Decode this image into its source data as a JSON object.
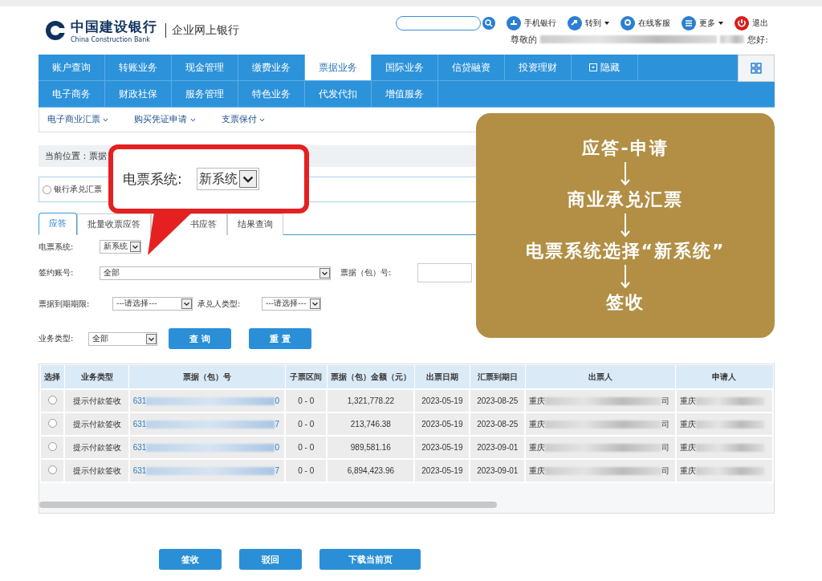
{
  "header": {
    "logo_cn": "中国建设银行",
    "logo_en": "China Construction Bank",
    "product": "企业网上银行",
    "links": [
      {
        "kind": "mobile",
        "label": "手机银行",
        "dropdown": false
      },
      {
        "kind": "goto",
        "label": "转到",
        "dropdown": true
      },
      {
        "kind": "service",
        "label": "在线客服",
        "dropdown": false
      },
      {
        "kind": "more",
        "label": "更多",
        "dropdown": true
      },
      {
        "kind": "exit",
        "label": "退出",
        "dropdown": false
      }
    ],
    "greeting_start": "尊敬的",
    "greeting_end": "您好:"
  },
  "nav": {
    "rows": [
      [
        {
          "label": "账户查询",
          "selected": false
        },
        {
          "label": "转账业务",
          "selected": false
        },
        {
          "label": "现金管理",
          "selected": false
        },
        {
          "label": "缴费业务",
          "selected": false
        },
        {
          "label": "票据业务",
          "selected": true
        },
        {
          "label": "国际业务",
          "selected": false
        },
        {
          "label": "信贷融资",
          "selected": false
        },
        {
          "label": "投资理财",
          "selected": false
        },
        {
          "label": "隐藏",
          "selected": false,
          "kind": "toggle"
        }
      ],
      [
        {
          "label": "电子商务",
          "selected": false
        },
        {
          "label": "财政社保",
          "selected": false
        },
        {
          "label": "服务管理",
          "selected": false
        },
        {
          "label": "特色业务",
          "selected": false
        },
        {
          "label": "代发代扣",
          "selected": false
        },
        {
          "label": "增值服务",
          "selected": false
        }
      ]
    ]
  },
  "subnav": [
    "电子商业汇票",
    "购买凭证申请",
    "支票保付"
  ],
  "breadcrumb": "当前位置：票据",
  "bill_type": {
    "label": "银行承兑汇票",
    "selected": false
  },
  "tabs": [
    {
      "label": "应答",
      "selected": true
    },
    {
      "label": "批量收票应答",
      "selected": false
    },
    {
      "label": "书应答",
      "selected": false
    },
    {
      "label": "结果查询",
      "selected": false
    }
  ],
  "form": {
    "system": {
      "label": "电票系统:",
      "value": "新系统"
    },
    "account": {
      "label": "签约账号:",
      "value": "全部"
    },
    "bill_no": {
      "label": "票据（包）号:"
    },
    "term": {
      "label": "票据到期期限:",
      "value": "---请选择---"
    },
    "acceptor": {
      "label": "承兑人类型:",
      "value": "---请选择---"
    },
    "biz_type": {
      "label": "业务类型:",
      "value": "全部"
    },
    "buttons": [
      "查 询",
      "重 置"
    ]
  },
  "table": {
    "columns": [
      "选择",
      "业务类型",
      "票据（包）号",
      "子票区间",
      "票据（包）金额（元）",
      "出票日期",
      "汇票到期日",
      "出票人",
      "申请人"
    ],
    "rows": [
      {
        "selected": false,
        "type": "提示付款签收",
        "bill_prefix": "631",
        "bill_suffix": "0",
        "range": "0 - 0",
        "amount": "1,321,778.22",
        "issue": "2023-05-19",
        "due": "2023-08-25",
        "drawer_prefix": "重庆",
        "drawer_suffix": "司",
        "applicant_prefix": "重庆"
      },
      {
        "selected": false,
        "type": "提示付款签收",
        "bill_prefix": "631",
        "bill_suffix": "7",
        "range": "0 - 0",
        "amount": "213,746.38",
        "issue": "2023-05-19",
        "due": "2023-08-25",
        "drawer_prefix": "重庆",
        "drawer_suffix": "司",
        "applicant_prefix": "重庆"
      },
      {
        "selected": false,
        "type": "提示付款签收",
        "bill_prefix": "631",
        "bill_suffix": "0",
        "range": "0 - 0",
        "amount": "989,581.16",
        "issue": "2023-05-19",
        "due": "2023-09-01",
        "drawer_prefix": "重庆",
        "drawer_suffix": "司",
        "applicant_prefix": "重庆"
      },
      {
        "selected": false,
        "type": "提示付款签收",
        "bill_prefix": "631",
        "bill_suffix": "7",
        "range": "0 - 0",
        "amount": "6,894,423.96",
        "issue": "2023-05-19",
        "due": "2023-09-01",
        "drawer_prefix": "重庆",
        "drawer_suffix": "司",
        "applicant_prefix": "重庆"
      }
    ]
  },
  "actions": [
    "签收",
    "驳回",
    "下载当前页"
  ],
  "callout": {
    "label": "电票系统:",
    "value": "新系统"
  },
  "steps": [
    "应答-申请",
    "商业承兑汇票",
    "电票系统选择“新系统”",
    "签收"
  ]
}
